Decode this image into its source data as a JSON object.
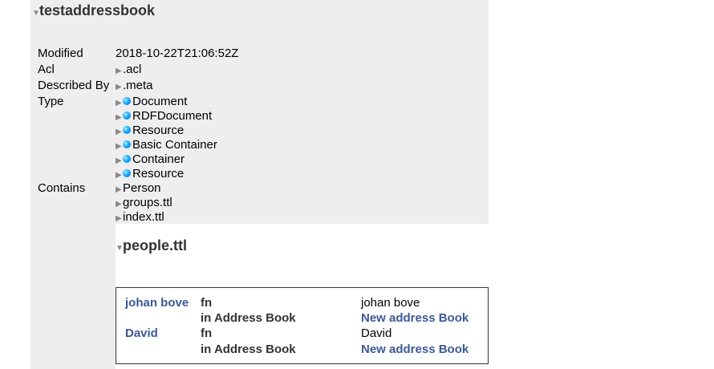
{
  "header": {
    "title": "testaddressbook"
  },
  "properties": {
    "modified": {
      "label": "Modified",
      "value": "2018-10-22T21:06:52Z"
    },
    "acl": {
      "label": "Acl",
      "value": ".acl"
    },
    "described_by": {
      "label": "Described By",
      "value": ".meta"
    },
    "type": {
      "label": "Type",
      "values": [
        "Document",
        "RDFDocument",
        "Resource",
        "Basic Container",
        "Container",
        "Resource"
      ]
    },
    "contains": {
      "label": "Contains",
      "values": [
        "Person",
        "groups.ttl",
        "index.ttl"
      ]
    }
  },
  "subdoc": {
    "title": "people.ttl",
    "rows": [
      {
        "subject": "johan bove",
        "predicate": "fn",
        "object": "johan bove"
      },
      {
        "subject": "",
        "predicate": "in Address Book",
        "object": "New address Book"
      },
      {
        "subject": "David",
        "predicate": "fn",
        "object": "David"
      },
      {
        "subject": "",
        "predicate": "in Address Book",
        "object": "New address Book"
      }
    ]
  },
  "colors": {
    "panel_bg": "#eeeeee",
    "link": "#3b5998",
    "type_dot": "#19a9ff"
  }
}
